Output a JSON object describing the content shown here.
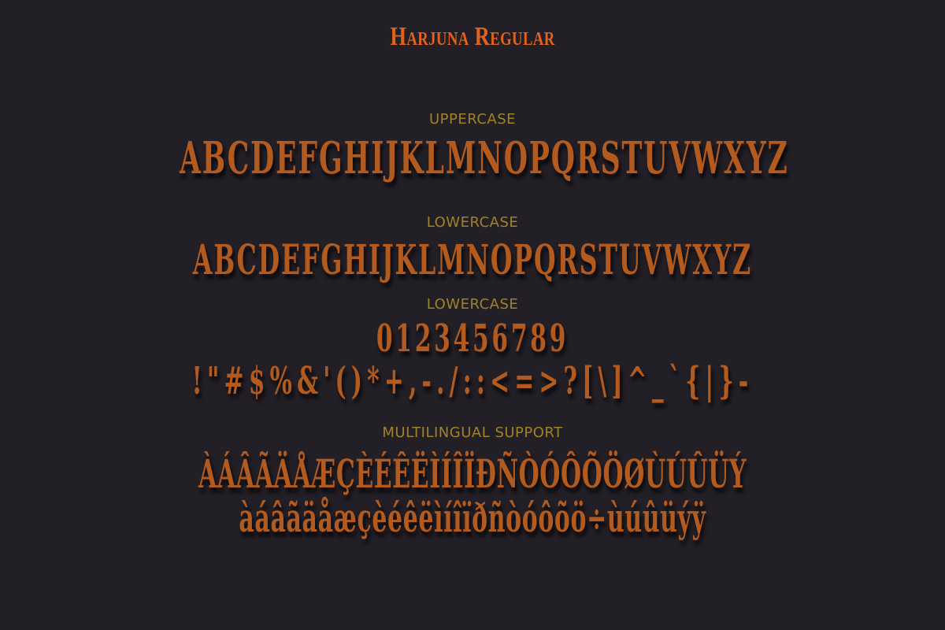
{
  "title": "Harjuna Regular",
  "sections": {
    "uppercase_label": "UPPERCASE",
    "uppercase_glyphs": "ABCDEFGHIJKLMNOPQRSTUVWXYZ",
    "lowercase_label": "LOWERCASE",
    "lowercase_glyphs": "ABCDEFGHIJKLMNOPQRSTUVWXYZ",
    "numbers_label": "LOWERCASE",
    "numbers_glyphs": "0123456789",
    "punctuation_glyphs": "!\"#$%&'()*+,-./::<=>?[\\]^_`{|}-",
    "multilingual_label": "MULTILINGUAL SUPPORT",
    "multilingual_line1": "ÀÁÂÃÄÅÆÇÈÉÊËÌÍÎÏÐÑÒÓÔÕÖØÙÚÛÜÝ",
    "multilingual_line2": "àáâãäåæçèéêëìíîïðñòóôõö÷ùúûüýÿ"
  },
  "colors": {
    "background": "#221f26",
    "title": "#e0621d",
    "label": "#a28227",
    "glyph": "#b35a1f"
  }
}
